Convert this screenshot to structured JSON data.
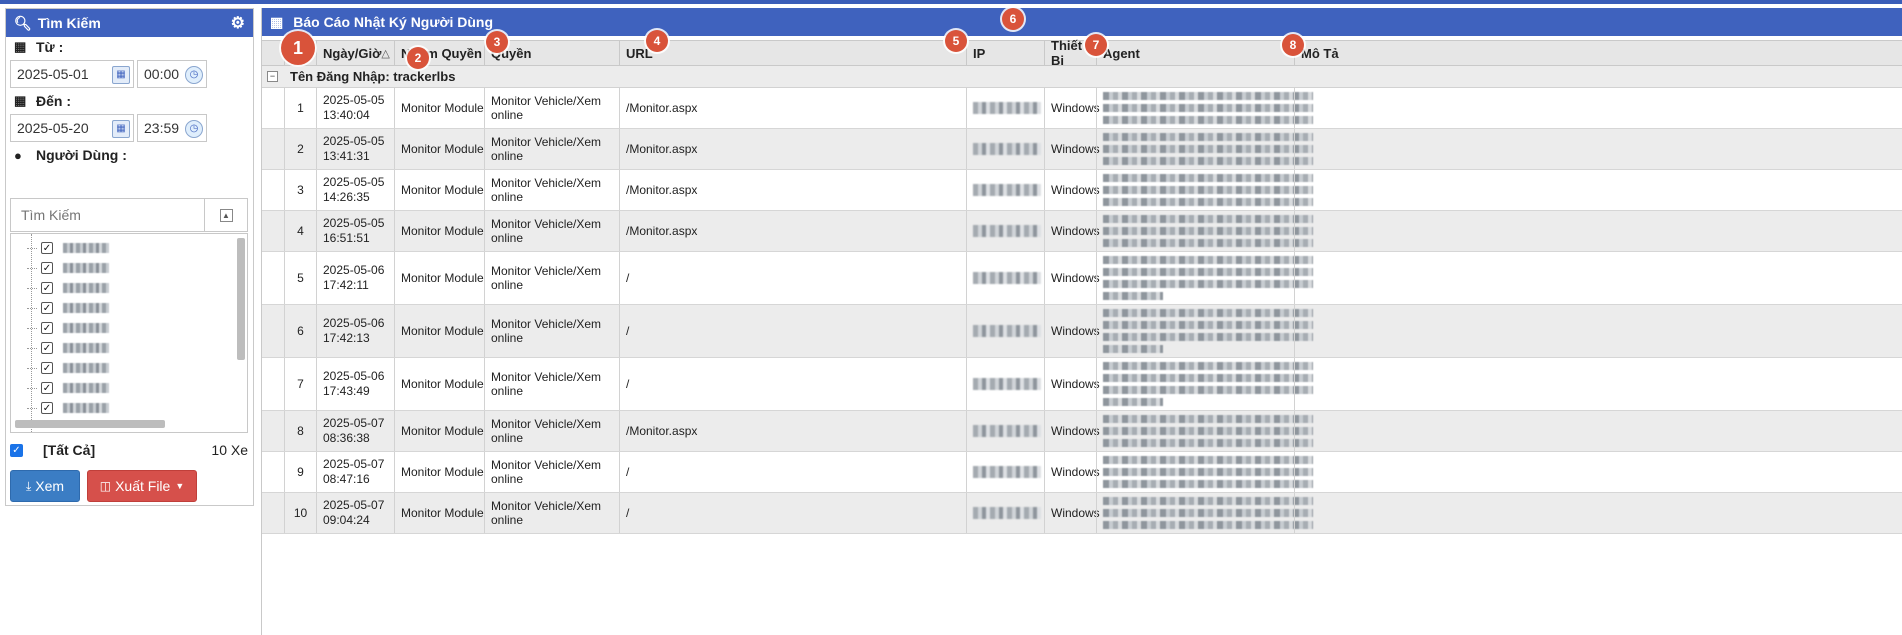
{
  "search_panel": {
    "title": "Tìm Kiếm",
    "from_label": "Từ :",
    "from_date": "2025-05-01",
    "from_time": "00:00",
    "to_label": "Đến :",
    "to_date": "2025-05-20",
    "to_time": "23:59",
    "user_label": "Người Dùng :",
    "search_placeholder": "Tìm Kiếm",
    "select_all_label": "[Tất Cả]",
    "vehicle_count": "10 Xe",
    "view_button": "Xem",
    "export_button": "Xuất File"
  },
  "report": {
    "title": "Báo Cáo Nhật Ký Người Dùng",
    "group_label": "Tên Đăng Nhập: trackerlbs",
    "columns": [
      "Ngày/Giờ",
      "Nhóm Quyền",
      "Quyền",
      "URL",
      "IP",
      "Thiết Bị",
      "Agent",
      "Mô Tả"
    ],
    "sort_indicator": "△",
    "rows": [
      {
        "no": "1",
        "date": "2025-05-05",
        "time": "13:40:04",
        "group": "Monitor Module",
        "permission": "Monitor Vehicle/Xem online",
        "url": "/Monitor.aspx",
        "device": "Windows",
        "desc": ""
      },
      {
        "no": "2",
        "date": "2025-05-05",
        "time": "13:41:31",
        "group": "Monitor Module",
        "permission": "Monitor Vehicle/Xem online",
        "url": "/Monitor.aspx",
        "device": "Windows",
        "desc": ""
      },
      {
        "no": "3",
        "date": "2025-05-05",
        "time": "14:26:35",
        "group": "Monitor Module",
        "permission": "Monitor Vehicle/Xem online",
        "url": "/Monitor.aspx",
        "device": "Windows",
        "desc": ""
      },
      {
        "no": "4",
        "date": "2025-05-05",
        "time": "16:51:51",
        "group": "Monitor Module",
        "permission": "Monitor Vehicle/Xem online",
        "url": "/Monitor.aspx",
        "device": "Windows",
        "desc": ""
      },
      {
        "no": "5",
        "date": "2025-05-06",
        "time": "17:42:11",
        "group": "Monitor Module",
        "permission": "Monitor Vehicle/Xem online",
        "url": "/",
        "device": "Windows",
        "desc": ""
      },
      {
        "no": "6",
        "date": "2025-05-06",
        "time": "17:42:13",
        "group": "Monitor Module",
        "permission": "Monitor Vehicle/Xem online",
        "url": "/",
        "device": "Windows",
        "desc": ""
      },
      {
        "no": "7",
        "date": "2025-05-06",
        "time": "17:43:49",
        "group": "Monitor Module",
        "permission": "Monitor Vehicle/Xem online",
        "url": "/",
        "device": "Windows",
        "desc": ""
      },
      {
        "no": "8",
        "date": "2025-05-07",
        "time": "08:36:38",
        "group": "Monitor Module",
        "permission": "Monitor Vehicle/Xem online",
        "url": "/Monitor.aspx",
        "device": "Windows",
        "desc": ""
      },
      {
        "no": "9",
        "date": "2025-05-07",
        "time": "08:47:16",
        "group": "Monitor Module",
        "permission": "Monitor Vehicle/Xem online",
        "url": "/",
        "device": "Windows",
        "desc": ""
      },
      {
        "no": "10",
        "date": "2025-05-07",
        "time": "09:04:24",
        "group": "Monitor Module",
        "permission": "Monitor Vehicle/Xem online",
        "url": "/",
        "device": "Windows",
        "desc": ""
      }
    ]
  },
  "annotations": [
    "1",
    "2",
    "3",
    "4",
    "5",
    "6",
    "7",
    "8"
  ],
  "colors": {
    "header_blue": "#3f62be",
    "badge_red": "#d9533a",
    "export_red": "#d6504b",
    "view_blue": "#3b7dc4"
  }
}
